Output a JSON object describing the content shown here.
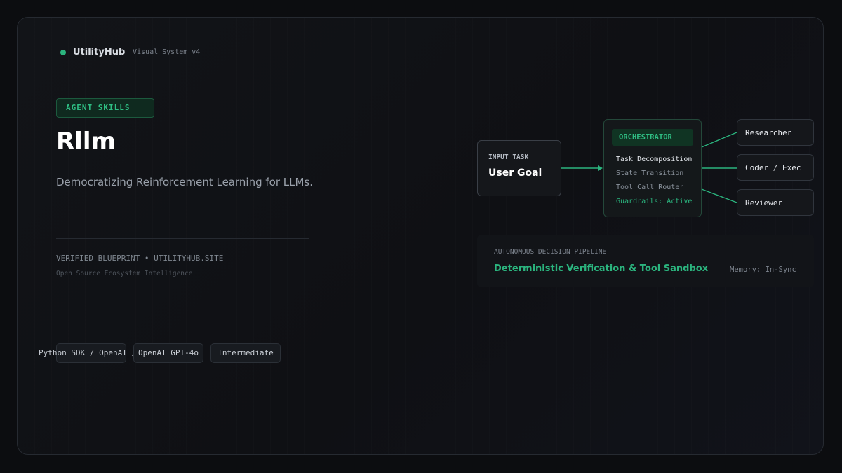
{
  "brand": {
    "name": "UtilityHub",
    "subtitle": "Visual System v4",
    "accent": "#2bb47e"
  },
  "hero": {
    "badge": "AGENT SKILLS",
    "title": "Rllm",
    "description": "Democratizing Reinforcement Learning for LLMs.",
    "verified": "VERIFIED BLUEPRINT • UTILITYHUB.SITE",
    "tagline": "Open Source Ecosystem Intelligence"
  },
  "tags": [
    "Python SDK / OpenAI /",
    "OpenAI GPT-4o",
    "Intermediate"
  ],
  "diagram": {
    "input": {
      "label": "INPUT TASK",
      "title": "User Goal"
    },
    "orchestrator": {
      "title": "ORCHESTRATOR",
      "items": [
        "Task Decomposition",
        "State Transition",
        "Tool Call Router",
        "Guardrails: Active"
      ]
    },
    "agents": [
      "Researcher",
      "Coder / Exec",
      "Reviewer"
    ]
  },
  "pipeline": {
    "label": "AUTONOMOUS DECISION PIPELINE",
    "title": "Deterministic Verification & Tool Sandbox",
    "memory": "Memory: In-Sync"
  }
}
